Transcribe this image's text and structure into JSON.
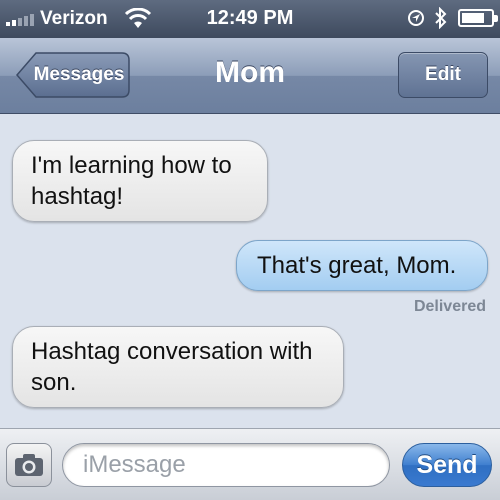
{
  "status_bar": {
    "carrier": "Verizon",
    "time": "12:49 PM"
  },
  "nav": {
    "back_label": "Messages",
    "title": "Mom",
    "edit_label": "Edit"
  },
  "messages": [
    {
      "direction": "incoming",
      "text": "I'm learning how to hashtag!"
    },
    {
      "direction": "outgoing",
      "text": "That's great, Mom."
    },
    {
      "direction": "incoming",
      "text": "Hashtag conversation with son."
    }
  ],
  "delivered_label": "Delivered",
  "input_bar": {
    "placeholder": "iMessage",
    "send_label": "Send"
  },
  "colors": {
    "incoming_bubble": "#ebebeb",
    "outgoing_bubble": "#b8daf6",
    "send_button": "#3a7ad0"
  },
  "icons": [
    "signal-icon",
    "wifi-icon",
    "location-icon",
    "bluetooth-icon",
    "battery-icon",
    "camera-icon"
  ]
}
